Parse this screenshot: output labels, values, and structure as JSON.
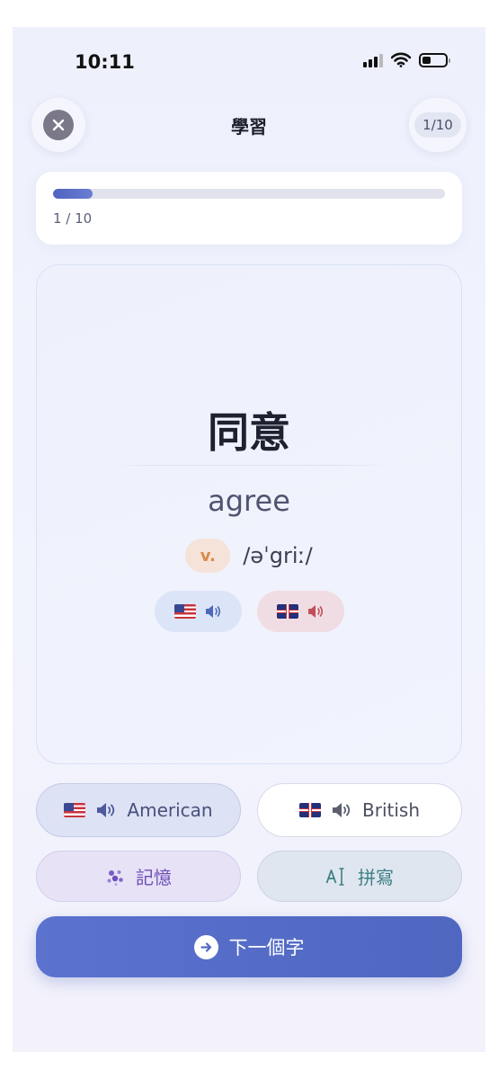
{
  "status_bar": {
    "time": "10:11"
  },
  "header": {
    "title": "學習",
    "counter": "1/10"
  },
  "progress": {
    "fraction": 0.1,
    "text": "1 / 10"
  },
  "card": {
    "chinese": "同意",
    "english": "agree",
    "part_of_speech": "v.",
    "phonetic": "/əˈgriː/"
  },
  "buttons": {
    "american_label": "American",
    "british_label": "British",
    "memory_label": "記憶",
    "spell_label": "拼寫",
    "next_label": "下一個字"
  },
  "colors": {
    "accent": "#5569c6",
    "pos_badge": "#d98a4c",
    "memory": "#6e4fb7",
    "spell": "#3d8086"
  },
  "icons": [
    "close-icon",
    "cellular-signal-icon",
    "wifi-icon",
    "battery-icon",
    "us-flag-icon",
    "uk-flag-icon",
    "speaker-icon",
    "sparkles-icon",
    "text-cursor-icon",
    "arrow-right-icon"
  ]
}
